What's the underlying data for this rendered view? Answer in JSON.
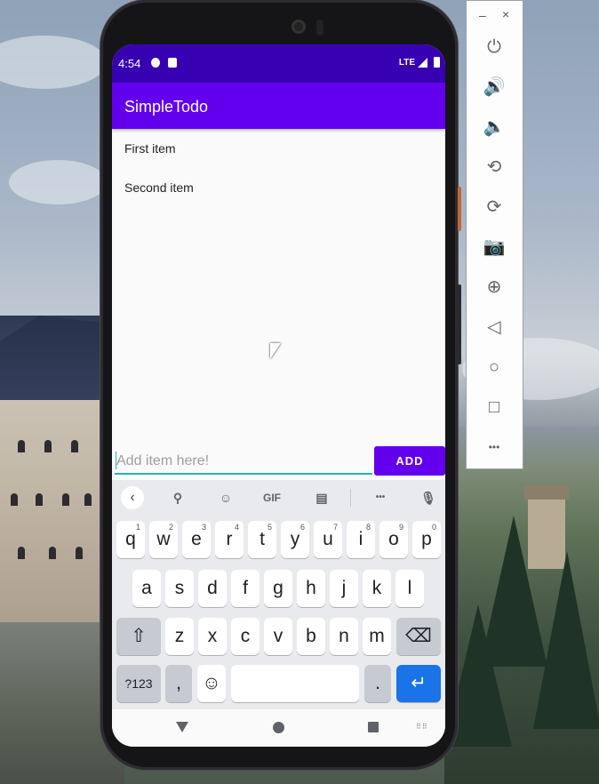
{
  "status_bar": {
    "time": "4:54",
    "network": "LTE",
    "icons": [
      "notification-icon",
      "sim-card-icon",
      "signal-icon",
      "battery-icon"
    ]
  },
  "app": {
    "title": "SimpleTodo",
    "bar_color": "#6200ee",
    "status_color": "#3700b3"
  },
  "todo_list": {
    "items": [
      {
        "label": "First item"
      },
      {
        "label": "Second item"
      }
    ]
  },
  "input": {
    "placeholder": "Add item here!",
    "value": "",
    "accent_color": "#26b5a8"
  },
  "add_button": {
    "label": "ADD"
  },
  "keyboard": {
    "toolbar": {
      "back": "‹",
      "search": "⚲",
      "sticker": "☺",
      "gif": "GIF",
      "clipboard": "▤",
      "more": "•••",
      "mic": "🎙"
    },
    "row1": [
      {
        "label": "q",
        "hint": "1"
      },
      {
        "label": "w",
        "hint": "2"
      },
      {
        "label": "e",
        "hint": "3"
      },
      {
        "label": "r",
        "hint": "4"
      },
      {
        "label": "t",
        "hint": "5"
      },
      {
        "label": "y",
        "hint": "6"
      },
      {
        "label": "u",
        "hint": "7"
      },
      {
        "label": "i",
        "hint": "8"
      },
      {
        "label": "o",
        "hint": "9"
      },
      {
        "label": "p",
        "hint": "0"
      }
    ],
    "row2": [
      "a",
      "s",
      "d",
      "f",
      "g",
      "h",
      "j",
      "k",
      "l"
    ],
    "row3": [
      "z",
      "x",
      "c",
      "v",
      "b",
      "n",
      "m"
    ],
    "shift": "⇧",
    "backspace": "⌫",
    "symbols": "?123",
    "comma": ",",
    "emoji": "☺",
    "period": ".",
    "enter": "↵",
    "enter_color": "#1a73e8"
  },
  "nav_bar": {
    "keyboard_switch": "⠿⠿"
  },
  "emulator_panel": {
    "minimize": "–",
    "close": "×",
    "buttons": [
      {
        "name": "power-icon",
        "glyph": "⏻"
      },
      {
        "name": "volume-up-icon",
        "glyph": "🔊"
      },
      {
        "name": "volume-down-icon",
        "glyph": "🔈"
      },
      {
        "name": "rotate-left-icon",
        "glyph": "⟲"
      },
      {
        "name": "rotate-right-icon",
        "glyph": "⟳"
      },
      {
        "name": "camera-icon",
        "glyph": "📷"
      },
      {
        "name": "zoom-icon",
        "glyph": "⊕"
      },
      {
        "name": "back-icon",
        "glyph": "◁"
      },
      {
        "name": "home-icon",
        "glyph": "○"
      },
      {
        "name": "overview-icon",
        "glyph": "□"
      },
      {
        "name": "more-icon",
        "glyph": "•••"
      }
    ]
  }
}
